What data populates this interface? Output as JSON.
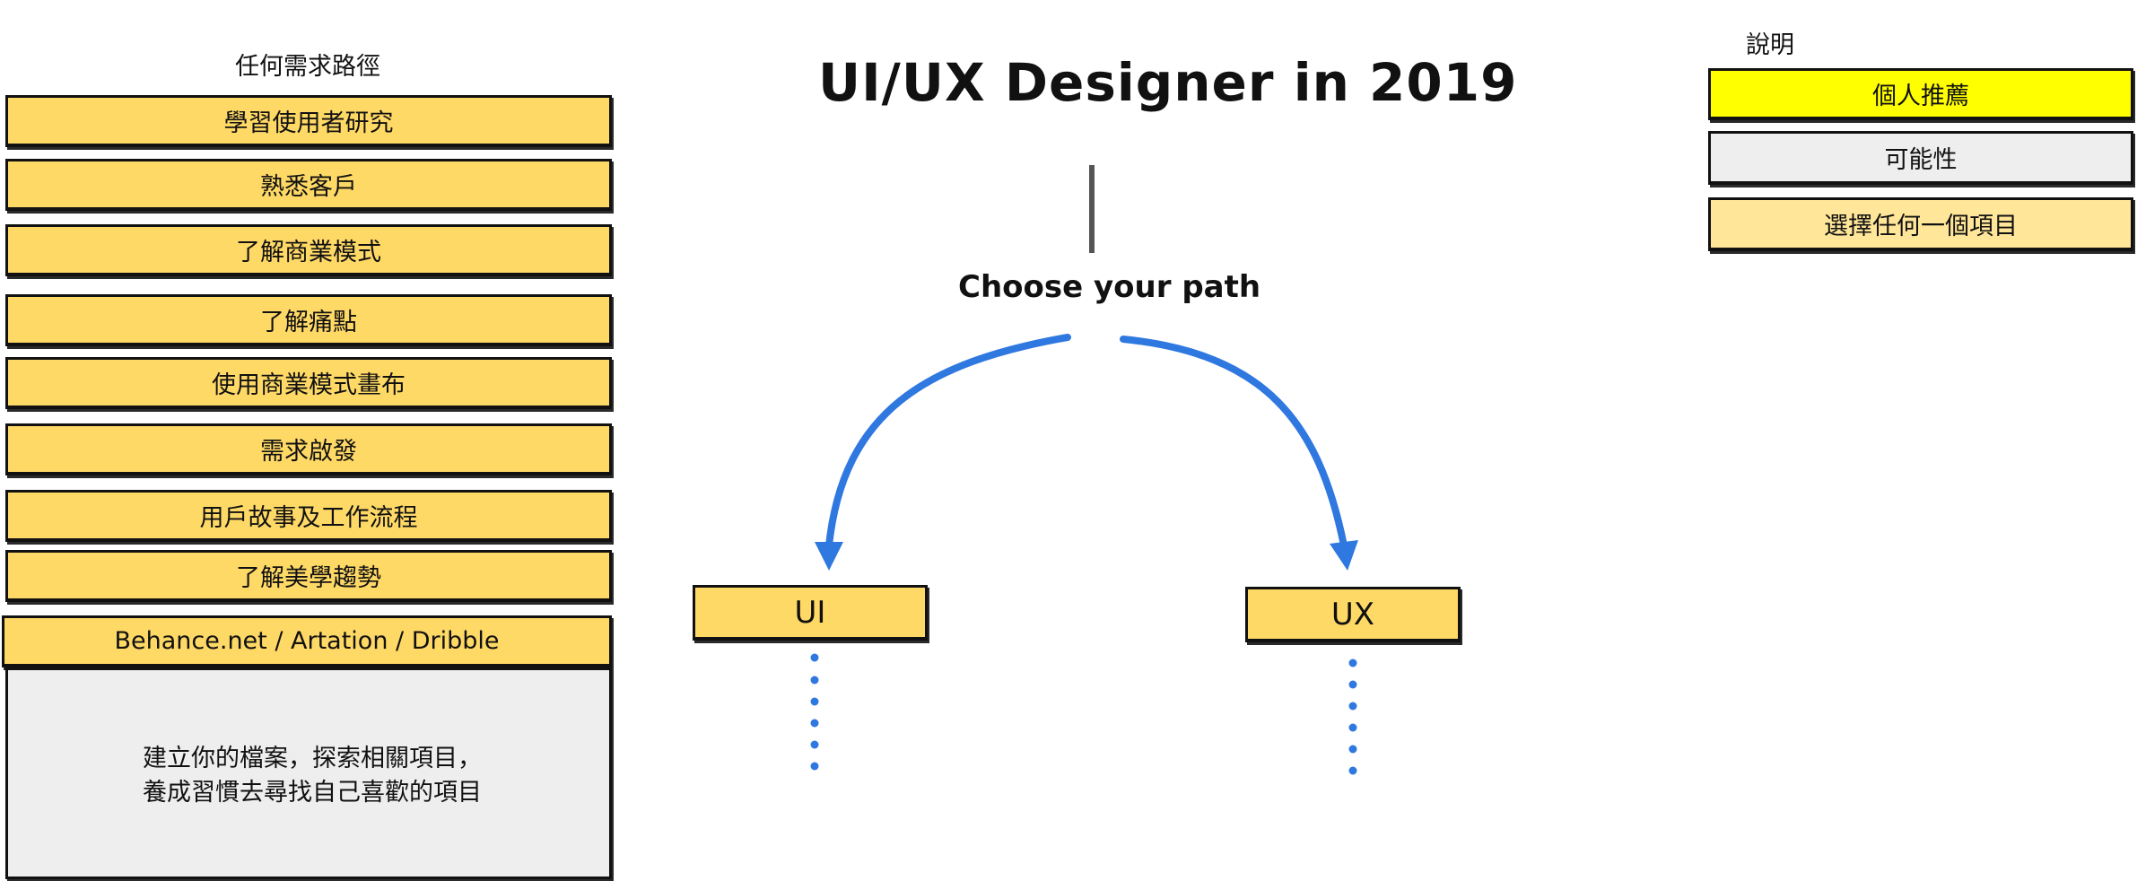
{
  "left_panel": {
    "heading": "任何需求路徑",
    "items": [
      "學習使用者研究",
      "熟悉客戶",
      "了解商業模式",
      "了解痛點",
      "使用商業模式畫布",
      "需求啟發",
      "用戶故事及工作流程",
      "了解美學趨勢",
      "Behance.net / Artation / Dribble"
    ],
    "description": {
      "line1": "建立你的檔案，探索相關項目，",
      "line2": "養成習慣去尋找自己喜歡的項目"
    }
  },
  "center": {
    "title": "UI/UX Designer in 2019",
    "subtitle": "Choose your path",
    "paths": {
      "ui": "UI",
      "ux": "UX"
    }
  },
  "legend": {
    "heading": "說明",
    "items": [
      "個人推薦",
      "可能性",
      "選擇任何一個項目"
    ]
  },
  "colors": {
    "item_orange": "#ffd966",
    "recommend_yellow": "#ffff00",
    "possibility_gray": "#eeeeee",
    "choose_lightorange": "#ffe699",
    "arrow_blue": "#2f78e0"
  }
}
